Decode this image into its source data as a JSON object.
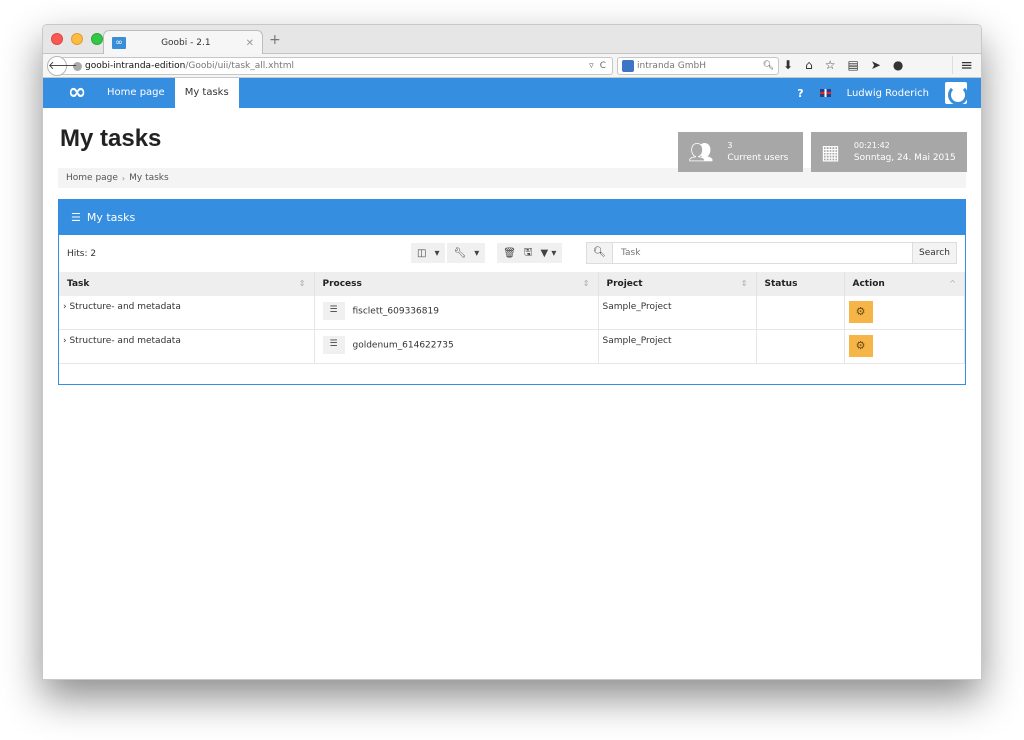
{
  "browser": {
    "tab_title": "Goobi - 2.1",
    "tab_favicon": "∞",
    "url_host": "goobi-intranda-edition",
    "url_path": "/Goobi/uii/task_all.xhtml",
    "search_engine_placeholder": "intranda GmbH",
    "icons": [
      "download-icon",
      "home-icon",
      "bookmark-star-icon",
      "reading-list-icon",
      "send-icon",
      "chat-icon"
    ]
  },
  "app": {
    "logo": "∞",
    "nav": [
      {
        "label": "Home page",
        "active": false
      },
      {
        "label": "My tasks",
        "active": true
      }
    ],
    "help": "?",
    "user_name": "Ludwig Roderich",
    "accent_color": "#368ee0",
    "action_color": "#f6b547"
  },
  "page": {
    "title": "My tasks",
    "breadcrumb": [
      "Home page",
      "My tasks"
    ],
    "stats": {
      "users_count": "3",
      "users_label": "Current users",
      "time": "00:21:42",
      "date": "Sonntag, 24. Mai 2015"
    }
  },
  "box": {
    "title": "My tasks",
    "hits": "Hits: 2",
    "search_placeholder": "Task",
    "search_button": "Search",
    "columns": [
      {
        "label": "Task",
        "sortable": true
      },
      {
        "label": "Process",
        "sortable": true
      },
      {
        "label": "Project",
        "sortable": true
      },
      {
        "label": "Status",
        "sortable": false
      },
      {
        "label": "Action",
        "sortable": true
      }
    ],
    "rows": [
      {
        "task": "› Structure- and metadata",
        "process": "fisclett_609336819",
        "project": "Sample_Project",
        "status": ""
      },
      {
        "task": "› Structure- and metadata",
        "process": "goldenum_614622735",
        "project": "Sample_Project",
        "status": ""
      }
    ]
  }
}
